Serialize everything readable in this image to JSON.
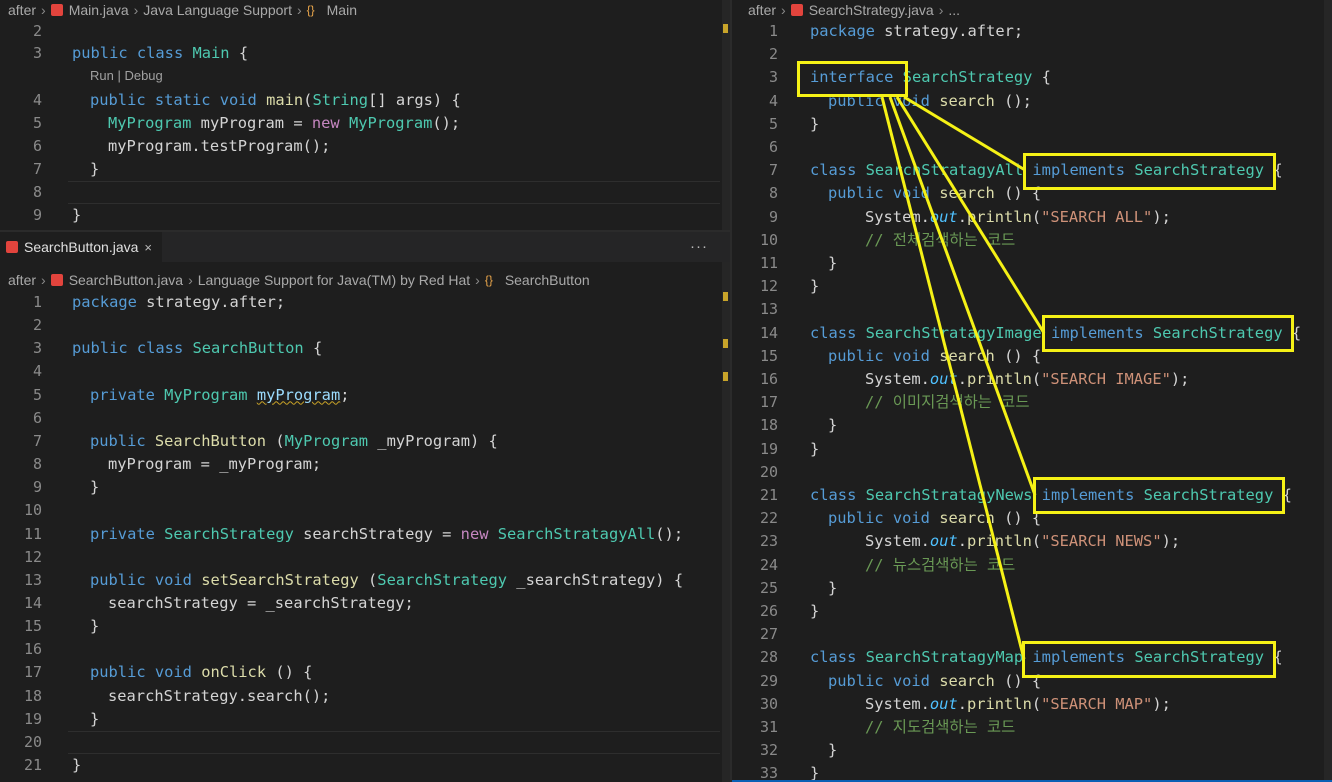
{
  "main_pane": {
    "breadcrumb": [
      "after",
      "Main.java",
      "Java Language Support",
      "Main"
    ],
    "codelens": "Run | Debug",
    "lines": [
      {
        "n": "2",
        "tokens": []
      },
      {
        "n": "3",
        "tokens": [
          [
            "kw",
            "public "
          ],
          [
            "kw",
            "class "
          ],
          [
            "ty",
            "Main "
          ],
          [
            "df",
            "{"
          ]
        ]
      },
      {
        "n": "4",
        "tokens": [
          [
            "kw",
            "public "
          ],
          [
            "kw",
            "static "
          ],
          [
            "kw",
            "void "
          ],
          [
            "fn",
            "main"
          ],
          [
            "df",
            "("
          ],
          [
            "ty",
            "String"
          ],
          [
            "df",
            "[] args) {"
          ]
        ]
      },
      {
        "n": "5",
        "tokens": [
          [
            "ty",
            "MyProgram "
          ],
          [
            "df",
            "myProgram = "
          ],
          [
            "nw",
            "new "
          ],
          [
            "ty",
            "MyProgram"
          ],
          [
            "df",
            "();"
          ]
        ]
      },
      {
        "n": "6",
        "tokens": [
          [
            "df",
            "myProgram.testProgram();"
          ]
        ]
      },
      {
        "n": "7",
        "tokens": [
          [
            "df",
            "}"
          ]
        ]
      },
      {
        "n": "8",
        "tokens": []
      },
      {
        "n": "9",
        "tokens": [
          [
            "df",
            "}"
          ]
        ]
      }
    ]
  },
  "button_pane": {
    "tab": {
      "label": "SearchButton.java",
      "close": "×",
      "more": "···"
    },
    "breadcrumb": [
      "after",
      "SearchButton.java",
      "Language Support for Java(TM) by Red Hat",
      "SearchButton"
    ],
    "lines": [
      {
        "n": "1",
        "tokens": [
          [
            "kw",
            "package "
          ],
          [
            "df",
            "strategy.after;"
          ]
        ]
      },
      {
        "n": "2",
        "tokens": []
      },
      {
        "n": "3",
        "tokens": [
          [
            "kw",
            "public "
          ],
          [
            "kw",
            "class "
          ],
          [
            "ty",
            "SearchButton "
          ],
          [
            "df",
            "{"
          ]
        ]
      },
      {
        "n": "4",
        "tokens": []
      },
      {
        "n": "5",
        "tokens": [
          [
            "kw",
            "private "
          ],
          [
            "ty",
            "MyProgram "
          ],
          [
            "sq",
            "myProgram"
          ],
          [
            "df",
            ";"
          ]
        ]
      },
      {
        "n": "6",
        "tokens": []
      },
      {
        "n": "7",
        "tokens": [
          [
            "kw",
            "public "
          ],
          [
            "fn",
            "SearchButton "
          ],
          [
            "df",
            "("
          ],
          [
            "ty",
            "MyProgram "
          ],
          [
            "df",
            "_myProgram) {"
          ]
        ]
      },
      {
        "n": "8",
        "tokens": [
          [
            "df",
            "myProgram = _myProgram;"
          ]
        ]
      },
      {
        "n": "9",
        "tokens": [
          [
            "df",
            "}"
          ]
        ]
      },
      {
        "n": "10",
        "tokens": []
      },
      {
        "n": "11",
        "tokens": [
          [
            "kw",
            "private "
          ],
          [
            "ty",
            "SearchStrategy "
          ],
          [
            "df",
            "searchStrategy = "
          ],
          [
            "nw",
            "new "
          ],
          [
            "ty",
            "SearchStratagyAll"
          ],
          [
            "df",
            "();"
          ]
        ]
      },
      {
        "n": "12",
        "tokens": []
      },
      {
        "n": "13",
        "tokens": [
          [
            "kw",
            "public "
          ],
          [
            "kw",
            "void "
          ],
          [
            "fn",
            "setSearchStrategy "
          ],
          [
            "df",
            "("
          ],
          [
            "ty",
            "SearchStrategy "
          ],
          [
            "df",
            "_searchStrategy) {"
          ]
        ]
      },
      {
        "n": "14",
        "tokens": [
          [
            "df",
            "searchStrategy = _searchStrategy;"
          ]
        ]
      },
      {
        "n": "15",
        "tokens": [
          [
            "df",
            "}"
          ]
        ]
      },
      {
        "n": "16",
        "tokens": []
      },
      {
        "n": "17",
        "tokens": [
          [
            "kw",
            "public "
          ],
          [
            "kw",
            "void "
          ],
          [
            "fn",
            "onClick "
          ],
          [
            "df",
            "() {"
          ]
        ]
      },
      {
        "n": "18",
        "tokens": [
          [
            "df",
            "searchStrategy.search();"
          ]
        ]
      },
      {
        "n": "19",
        "tokens": [
          [
            "df",
            "}"
          ]
        ]
      },
      {
        "n": "20",
        "tokens": []
      },
      {
        "n": "21",
        "tokens": [
          [
            "df",
            "}"
          ]
        ]
      }
    ]
  },
  "strategy_pane": {
    "breadcrumb": [
      "after",
      "SearchStrategy.java",
      "..."
    ],
    "lines": [
      {
        "n": "1",
        "tokens": [
          [
            "kw",
            "package "
          ],
          [
            "df",
            "strategy.after;"
          ]
        ]
      },
      {
        "n": "2",
        "tokens": []
      },
      {
        "n": "3",
        "tokens": [
          [
            "kw",
            "interface "
          ],
          [
            "ty",
            "SearchStrategy "
          ],
          [
            "df",
            "{"
          ]
        ]
      },
      {
        "n": "4",
        "tokens": [
          [
            "kw",
            "public "
          ],
          [
            "kw",
            "void "
          ],
          [
            "fn",
            "search "
          ],
          [
            "df",
            "();"
          ]
        ]
      },
      {
        "n": "5",
        "tokens": [
          [
            "df",
            "}"
          ]
        ]
      },
      {
        "n": "6",
        "tokens": []
      },
      {
        "n": "7",
        "tokens": [
          [
            "kw",
            "class "
          ],
          [
            "ty",
            "SearchStratagyAll "
          ],
          [
            "kw",
            "implements "
          ],
          [
            "ty",
            "SearchStrategy "
          ],
          [
            "df",
            "{"
          ]
        ]
      },
      {
        "n": "8",
        "tokens": [
          [
            "kw",
            "public "
          ],
          [
            "kw",
            "void "
          ],
          [
            "fn",
            "search "
          ],
          [
            "df",
            "() {"
          ]
        ]
      },
      {
        "n": "9",
        "tokens": [
          [
            "df",
            "System."
          ],
          [
            "it",
            "out"
          ],
          [
            "df",
            "."
          ],
          [
            "fn",
            "println"
          ],
          [
            "df",
            "("
          ],
          [
            "st",
            "\"SEARCH ALL\""
          ],
          [
            "df",
            ");"
          ]
        ]
      },
      {
        "n": "10",
        "tokens": [
          [
            "cm",
            "// 전체검색하는 코드"
          ]
        ]
      },
      {
        "n": "11",
        "tokens": [
          [
            "df",
            "}"
          ]
        ]
      },
      {
        "n": "12",
        "tokens": [
          [
            "df",
            "}"
          ]
        ]
      },
      {
        "n": "13",
        "tokens": []
      },
      {
        "n": "14",
        "tokens": [
          [
            "kw",
            "class "
          ],
          [
            "ty",
            "SearchStratagyImage "
          ],
          [
            "kw",
            "implements "
          ],
          [
            "ty",
            "SearchStrategy "
          ],
          [
            "df",
            "{"
          ]
        ]
      },
      {
        "n": "15",
        "tokens": [
          [
            "kw",
            "public "
          ],
          [
            "kw",
            "void "
          ],
          [
            "fn",
            "search "
          ],
          [
            "df",
            "() {"
          ]
        ]
      },
      {
        "n": "16",
        "tokens": [
          [
            "df",
            "System."
          ],
          [
            "it",
            "out"
          ],
          [
            "df",
            "."
          ],
          [
            "fn",
            "println"
          ],
          [
            "df",
            "("
          ],
          [
            "st",
            "\"SEARCH IMAGE\""
          ],
          [
            "df",
            ");"
          ]
        ]
      },
      {
        "n": "17",
        "tokens": [
          [
            "cm",
            "// 이미지검색하는 코드"
          ]
        ]
      },
      {
        "n": "18",
        "tokens": [
          [
            "df",
            "}"
          ]
        ]
      },
      {
        "n": "19",
        "tokens": [
          [
            "df",
            "}"
          ]
        ]
      },
      {
        "n": "20",
        "tokens": []
      },
      {
        "n": "21",
        "tokens": [
          [
            "kw",
            "class "
          ],
          [
            "ty",
            "SearchStratagyNews "
          ],
          [
            "kw",
            "implements "
          ],
          [
            "ty",
            "SearchStrategy "
          ],
          [
            "df",
            "{"
          ]
        ]
      },
      {
        "n": "22",
        "tokens": [
          [
            "kw",
            "public "
          ],
          [
            "kw",
            "void "
          ],
          [
            "fn",
            "search "
          ],
          [
            "df",
            "() {"
          ]
        ]
      },
      {
        "n": "23",
        "tokens": [
          [
            "df",
            "System."
          ],
          [
            "it",
            "out"
          ],
          [
            "df",
            "."
          ],
          [
            "fn",
            "println"
          ],
          [
            "df",
            "("
          ],
          [
            "st",
            "\"SEARCH NEWS\""
          ],
          [
            "df",
            ");"
          ]
        ]
      },
      {
        "n": "24",
        "tokens": [
          [
            "cm",
            "// 뉴스검색하는 코드"
          ]
        ]
      },
      {
        "n": "25",
        "tokens": [
          [
            "df",
            "}"
          ]
        ]
      },
      {
        "n": "26",
        "tokens": [
          [
            "df",
            "}"
          ]
        ]
      },
      {
        "n": "27",
        "tokens": []
      },
      {
        "n": "28",
        "tokens": [
          [
            "kw",
            "class "
          ],
          [
            "ty",
            "SearchStratagyMap "
          ],
          [
            "kw",
            "implements "
          ],
          [
            "ty",
            "SearchStrategy "
          ],
          [
            "df",
            "{"
          ]
        ]
      },
      {
        "n": "29",
        "tokens": [
          [
            "kw",
            "public "
          ],
          [
            "kw",
            "void "
          ],
          [
            "fn",
            "search "
          ],
          [
            "df",
            "() {"
          ]
        ]
      },
      {
        "n": "30",
        "tokens": [
          [
            "df",
            "System."
          ],
          [
            "it",
            "out"
          ],
          [
            "df",
            "."
          ],
          [
            "fn",
            "println"
          ],
          [
            "df",
            "("
          ],
          [
            "st",
            "\"SEARCH MAP\""
          ],
          [
            "df",
            ");"
          ]
        ]
      },
      {
        "n": "31",
        "tokens": [
          [
            "cm",
            "// 지도검색하는 코드"
          ]
        ]
      },
      {
        "n": "32",
        "tokens": [
          [
            "df",
            "}"
          ]
        ]
      },
      {
        "n": "33",
        "tokens": [
          [
            "df",
            "}"
          ]
        ]
      }
    ]
  },
  "annotation": {
    "color": "#f5f116"
  }
}
